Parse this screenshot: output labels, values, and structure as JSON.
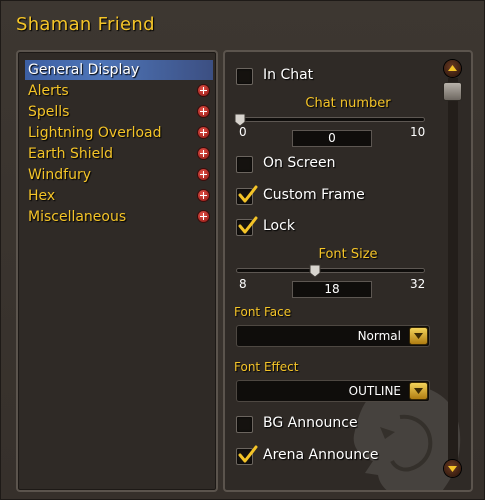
{
  "window": {
    "title": "Shaman Friend"
  },
  "nav": {
    "items": [
      {
        "label": "General Display",
        "active": true,
        "expandable": false
      },
      {
        "label": "Alerts",
        "active": false,
        "expandable": true
      },
      {
        "label": "Spells",
        "active": false,
        "expandable": true
      },
      {
        "label": "Lightning Overload",
        "active": false,
        "expandable": true
      },
      {
        "label": "Earth Shield",
        "active": false,
        "expandable": true
      },
      {
        "label": "Windfury",
        "active": false,
        "expandable": true
      },
      {
        "label": "Hex",
        "active": false,
        "expandable": true
      },
      {
        "label": "Miscellaneous",
        "active": false,
        "expandable": true
      }
    ]
  },
  "options": {
    "in_chat": {
      "label": "In Chat",
      "checked": false
    },
    "chat_number": {
      "label": "Chat number",
      "min": "0",
      "max": "10",
      "value": "0",
      "fraction": 0.0
    },
    "on_screen": {
      "label": "On Screen",
      "checked": false
    },
    "custom_frame": {
      "label": "Custom Frame",
      "checked": true
    },
    "lock": {
      "label": "Lock",
      "checked": true
    },
    "font_size": {
      "label": "Font Size",
      "min": "8",
      "max": "32",
      "value": "18",
      "fraction": 0.4167
    },
    "font_face": {
      "label": "Font Face",
      "value": "Normal"
    },
    "font_effect": {
      "label": "Font Effect",
      "value": "OUTLINE"
    },
    "bg_announce": {
      "label": "BG Announce",
      "checked": false
    },
    "arena_announce": {
      "label": "Arena Announce",
      "checked": true
    }
  },
  "colors": {
    "gold": "#f4c428",
    "selection": "#4e75b8",
    "panel": "#2f2a26"
  },
  "icons": {
    "expand": "plus-icon",
    "check": "checkmark-icon",
    "scroll_up": "scroll-up-icon",
    "scroll_down": "scroll-down-icon",
    "dropdown": "chevron-down-icon"
  }
}
